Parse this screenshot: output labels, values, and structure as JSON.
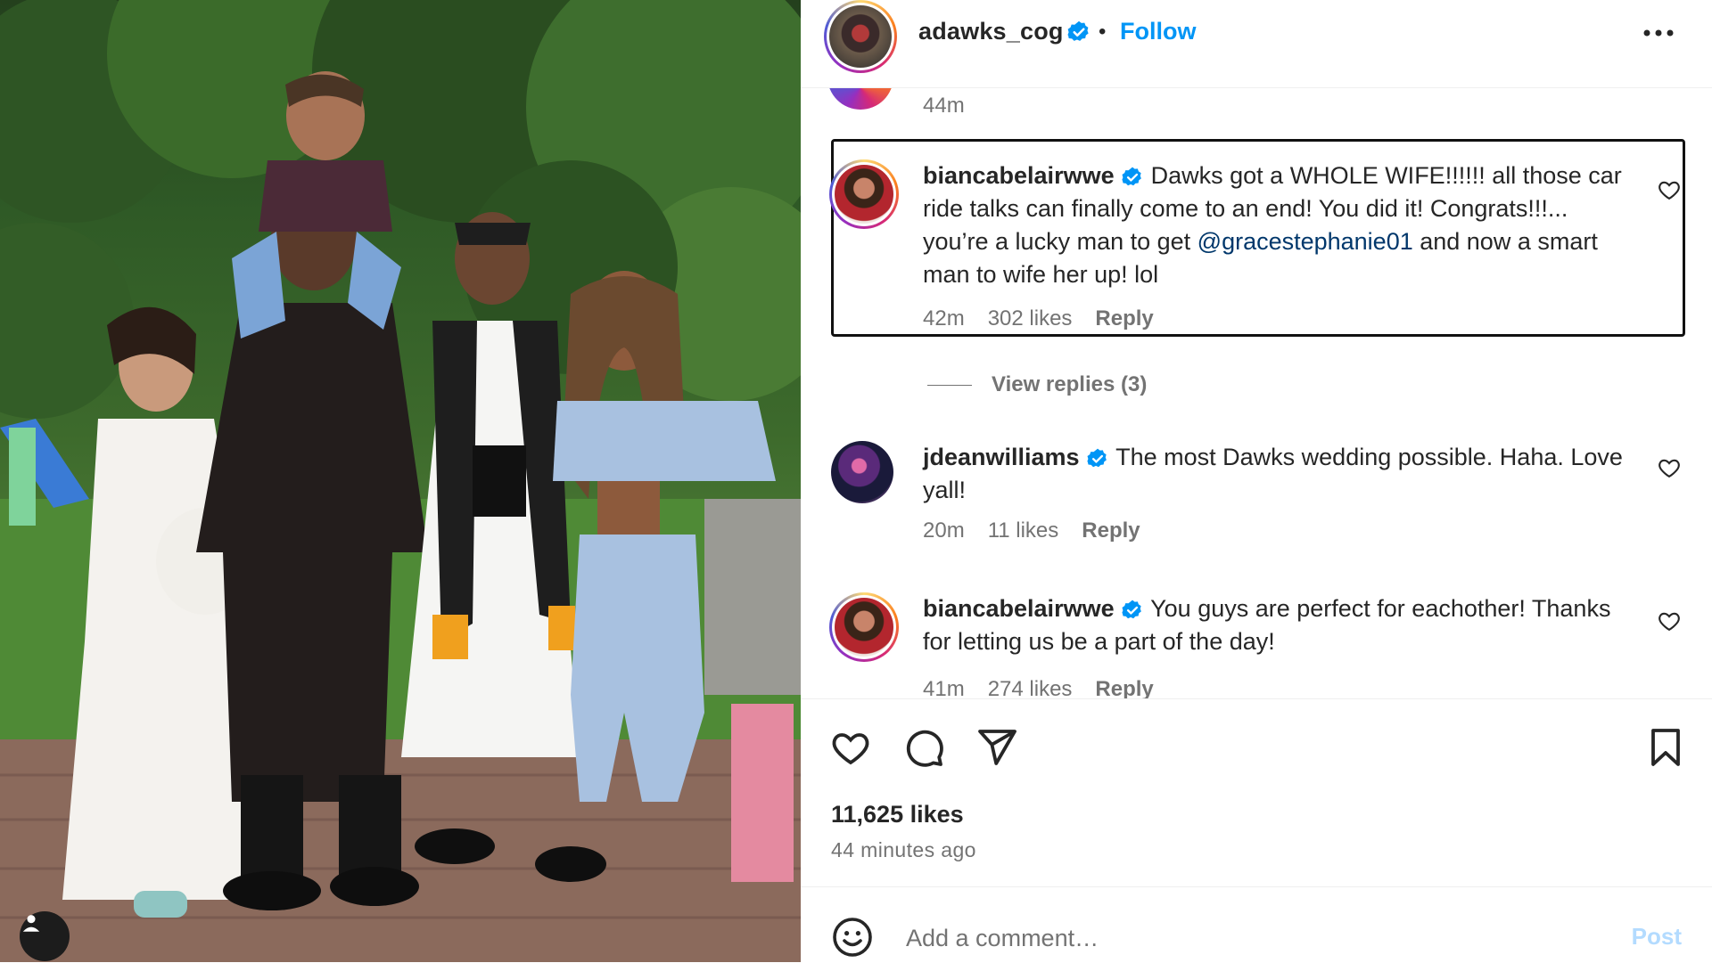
{
  "post": {
    "author": "adawks_cog",
    "follow_label": "Follow",
    "separator": "•",
    "top_timestamp": "44m",
    "likes": "11,625 likes",
    "time_ago": "44 minutes ago"
  },
  "comments": [
    {
      "username": "biancabelairwwe",
      "text_before": "Dawks got a WHOLE WIFE!!!!!! all those car ride talks can finally come to an end! You did it! Congrats!!!... you’re a lucky man to get ",
      "mention": "@gracestephanie01",
      "text_after": " and now a smart man to wife her up! lol",
      "time": "42m",
      "likes": "302 likes",
      "reply_label": "Reply",
      "highlighted": true
    },
    {
      "username": "jdeanwilliams",
      "text": "The most Dawks wedding possible. Haha. Love yall!",
      "time": "20m",
      "likes": "11 likes",
      "reply_label": "Reply"
    },
    {
      "username": "biancabelairwwe",
      "text": "You guys are perfect for eachother! Thanks for letting us be a part of the day!",
      "time": "41m",
      "likes": "274 likes",
      "reply_label": "Reply"
    }
  ],
  "view_replies": "View replies (3)",
  "composer": {
    "placeholder": "Add a comment…",
    "post_label": "Post"
  },
  "icons": {
    "verified": "verified-badge-icon",
    "more": "more-options-icon",
    "like": "heart-icon",
    "comment": "comment-icon",
    "share": "send-icon",
    "save": "bookmark-icon",
    "emoji": "emoji-icon",
    "user_tag": "user-tag-icon"
  },
  "colors": {
    "accent": "#0095f6",
    "mention": "#00376b",
    "muted": "#737373",
    "text": "#262626"
  }
}
